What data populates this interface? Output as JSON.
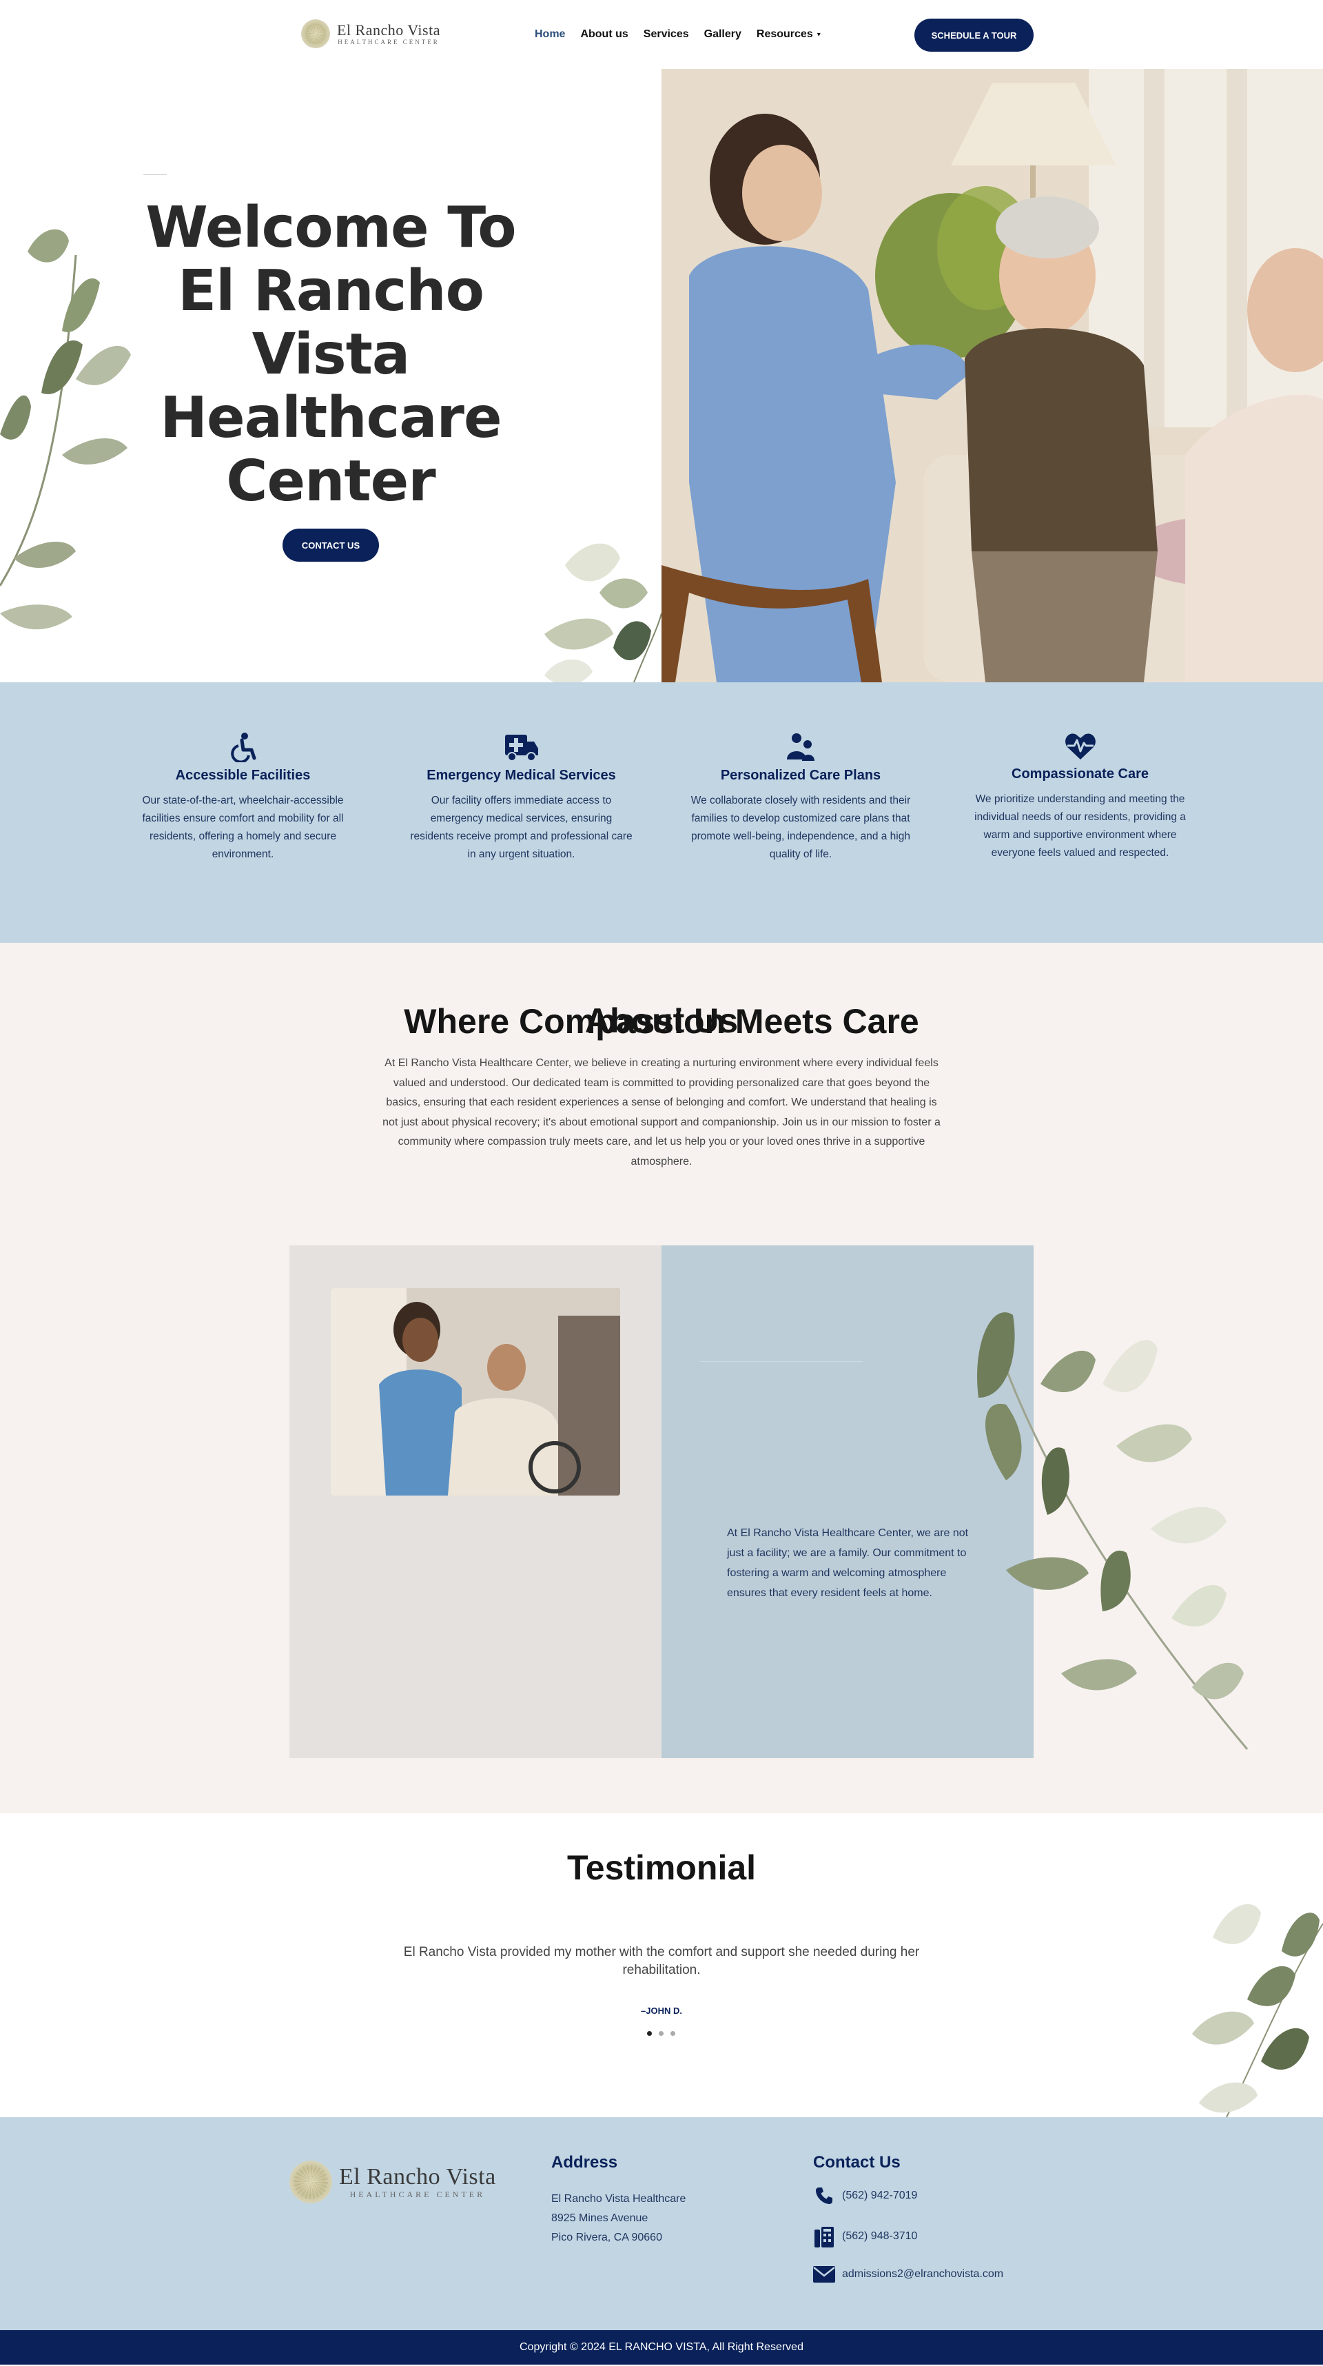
{
  "brand": {
    "logo_title": "El Rancho Vista",
    "logo_subtitle": "HEALTHCARE CENTER"
  },
  "nav": {
    "items": [
      {
        "label": "Home",
        "active": true
      },
      {
        "label": "About us",
        "active": false
      },
      {
        "label": "Services",
        "active": false
      },
      {
        "label": "Gallery",
        "active": false
      },
      {
        "label": "Resources",
        "active": false,
        "dropdown": true
      }
    ],
    "cta_label": "SCHEDULE A TOUR"
  },
  "hero": {
    "title": "Welcome To El Rancho Vista Healthcare Center",
    "button_label": "CONTACT US"
  },
  "features": [
    {
      "icon": "wheelchair-icon",
      "title": "Accessible Facilities",
      "text": "Our state-of-the-art, wheelchair-accessible facilities ensure comfort and mobility for all residents, offering a homely and secure environment."
    },
    {
      "icon": "ambulance-icon",
      "title": "Emergency Medical Services",
      "text": "Our facility offers immediate access to emergency medical services, ensuring residents receive prompt and professional care in any urgent situation."
    },
    {
      "icon": "people-icon",
      "title": "Personalized Care Plans",
      "text": "We collaborate closely with residents and their families to develop customized care plans that promote well-being, independence, and a high quality of life."
    },
    {
      "icon": "heart-pulse-icon",
      "title": "Compassionate Care",
      "text": "We prioritize understanding and meeting the individual needs of our residents, providing a warm and supportive environment where everyone feels valued and respected."
    }
  ],
  "about": {
    "heading": "About Us",
    "text": "At El Rancho Vista Healthcare Center, we believe in creating a nurturing environment where every individual feels valued and understood. Our dedicated team is committed to providing personalized care that goes beyond the basics, ensuring that each resident experiences a sense of belonging and comfort. We understand that healing is not just about physical recovery; it's about emotional support and companionship. Join us in our mission to foster a community where compassion truly meets care, and let us help you or your loved ones thrive in a supportive atmosphere.",
    "feature_title": "Where Compassion Meets Care",
    "feature_text": "At El Rancho Vista Healthcare Center, we are not just a facility; we are a family. Our commitment to fostering a warm and welcoming atmosphere ensures that every resident feels at home."
  },
  "testimonial": {
    "heading": "Testimonial",
    "quote": "El Rancho Vista provided my mother with the comfort and support she needed during her rehabilitation.",
    "author": "–JOHN D.",
    "slides": 3,
    "active_slide": 1
  },
  "footer": {
    "address_heading": "Address",
    "address_lines": [
      "El Rancho Vista Healthcare",
      "8925 Mines Avenue",
      "Pico Rivera, CA 90660"
    ],
    "contact_heading": "Contact Us",
    "phone": "(562) 942-7019",
    "fax": "(562) 948-3710",
    "email": "admissions2@elranchovista.com",
    "copyright": "Copyright © 2024 EL RANCHO VISTA, All Right Reserved"
  },
  "colors": {
    "navy": "#0a2159",
    "light_blue": "#c1d5e3",
    "cream": "#f7f2ef",
    "sage": "#8f9b7d"
  }
}
